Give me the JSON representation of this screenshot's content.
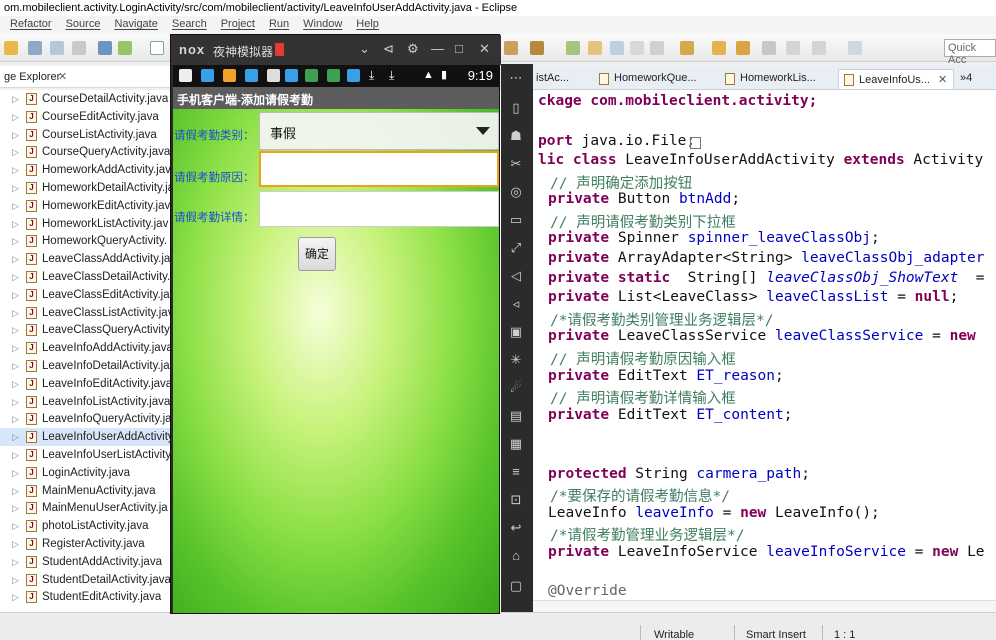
{
  "window": {
    "title": "om.mobileclient.activity.LoginActivity/src/com/mobileclient/activity/LeaveInfoUserAddActivity.java - Eclipse"
  },
  "menu": [
    "Refactor",
    "Source",
    "Navigate",
    "Search",
    "Project",
    "Run",
    "Window",
    "Help"
  ],
  "toolbar": {
    "quick_access": "Quick Acc"
  },
  "package_explorer": {
    "title": "ge Explorer",
    "files": [
      "CourseDetailActivity.java",
      "CourseEditActivity.java",
      "CourseListActivity.java",
      "CourseQueryActivity.java",
      "HomeworkAddActivity.java",
      "HomeworkDetailActivity.ja",
      "HomeworkEditActivity.java",
      "HomeworkListActivity.jav",
      "HomeworkQueryActivity.",
      "LeaveClassAddActivity.jav",
      "LeaveClassDetailActivity.j",
      "LeaveClassEditActivity.jav",
      "LeaveClassListActivity.jav",
      "LeaveClassQueryActivity.ja",
      "LeaveInfoAddActivity.java",
      "LeaveInfoDetailActivity.ja",
      "LeaveInfoEditActivity.java",
      "LeaveInfoListActivity.java",
      "LeaveInfoQueryActivity.ja",
      "LeaveInfoUserAddActivity",
      "LeaveInfoUserListActivity",
      "LoginActivity.java",
      "MainMenuActivity.java",
      "MainMenuUserActivity.ja",
      "photoListActivity.java",
      "RegisterActivity.java",
      "StudentAddActivity.java",
      "StudentDetailActivity.java",
      "StudentEditActivity.java"
    ],
    "selected_index": 19
  },
  "editor": {
    "tabs": [
      "istAc...",
      "HomeworkQue...",
      "HomeworkLis...",
      "LeaveInfoUs...",
      "»4"
    ],
    "active_tab_index": 3,
    "code": {
      "l1": "ckage com.mobileclient.activity;",
      "l2_kw": "port",
      "l2_rest": " java.io.File;",
      "l3_kw1": "lic class",
      "l3_name": " LeaveInfoUserAddActivity ",
      "l3_kw2": "extends",
      "l3_rest": " Activity",
      "c1": "// 声明确定添加按钮",
      "l4_kw": "private",
      "l4_type": " Button ",
      "l4_field": "btnAdd",
      "l4_end": ";",
      "c2": "// 声明请假考勤类别下拉框",
      "l5_kw": "private",
      "l5_type": " Spinner ",
      "l5_field": "spinner_leaveClassObj",
      "l5_end": ";",
      "l6_kw": "private",
      "l6_type": " ArrayAdapter<String> ",
      "l6_field": "leaveClassObj_adapter",
      "l7_kw": "private static",
      "l7_type": "  String[] ",
      "l7_field": "leaveClassObj_ShowText",
      "l7_end": "  =",
      "l8_kw": "private",
      "l8_type": " List<LeaveClass> ",
      "l8_field": "leaveClassList",
      "l8_mid": " = ",
      "l8_null": "null",
      "l8_end": ";",
      "c3": "/*请假考勤类别管理业务逻辑层*/",
      "l9_kw": "private",
      "l9_type": " LeaveClassService ",
      "l9_field": "leaveClassService",
      "l9_mid": " = ",
      "l9_new": "new",
      "c4": "// 声明请假考勤原因输入框",
      "l10_kw": "private",
      "l10_type": " EditText ",
      "l10_field": "ET_reason",
      "l10_end": ";",
      "c5": "// 声明请假考勤详情输入框",
      "l11_kw": "private",
      "l11_type": " EditText ",
      "l11_field": "ET_content",
      "l11_end": ";",
      "l12_kw": "protected",
      "l12_type": " String ",
      "l12_field": "carmera_path",
      "l12_end": ";",
      "c6": "/*要保存的请假考勤信息*/",
      "l13_type": "LeaveInfo ",
      "l13_field": "leaveInfo",
      "l13_mid": " = ",
      "l13_new": "new",
      "l13_end": " LeaveInfo();",
      "c7": "/*请假考勤管理业务逻辑层*/",
      "l14_kw": "private",
      "l14_type": " LeaveInfoService ",
      "l14_field": "leaveInfoService",
      "l14_mid": " = ",
      "l14_new": "new",
      "l14_end": " Le",
      "l15": "@Override"
    }
  },
  "status_bar": {
    "mode": "Writable",
    "insert": "Smart Insert",
    "position": "1 : 1"
  },
  "emulator": {
    "logo": "nox",
    "title": "夜神模拟器",
    "controls": [
      "⌄",
      "⊲",
      "⚙",
      "—",
      "□",
      "✕"
    ],
    "phone": {
      "clock": "9:19",
      "app_title": "手机客户端-添加请假考勤",
      "form": {
        "type_label": "请假考勤类别：",
        "type_value": "事假",
        "reason_label": "请假考勤原因：",
        "reason_value": "",
        "detail_label": "请假考勤详情：",
        "detail_value": "",
        "confirm_label": "确定"
      }
    }
  },
  "colors": {
    "keyword": "#7f0055",
    "comment": "#3f7f5f",
    "field": "#0000c0",
    "label_blue": "#1a4fd0",
    "focus_orange": "#f0a020"
  }
}
